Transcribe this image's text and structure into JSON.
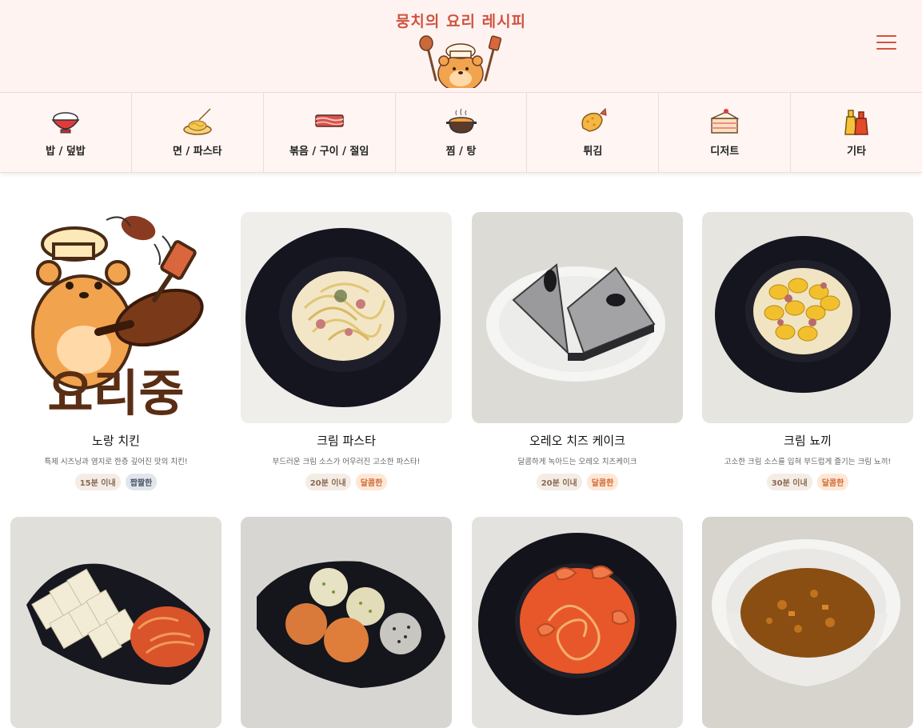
{
  "header": {
    "title": "뭉치의 요리 레시피",
    "menu_icon": "hamburger-menu-icon",
    "accent_color": "#d0533f"
  },
  "categories": [
    {
      "label": "밥 / 덮밥",
      "icon": "rice-bowl-icon"
    },
    {
      "label": "면 / 파스타",
      "icon": "noodle-plate-icon"
    },
    {
      "label": "볶음 / 구이 / 절임",
      "icon": "bacon-icon"
    },
    {
      "label": "찜 / 탕",
      "icon": "stew-pot-icon"
    },
    {
      "label": "튀김",
      "icon": "fried-shrimp-icon"
    },
    {
      "label": "디저트",
      "icon": "cake-slice-icon"
    },
    {
      "label": "기타",
      "icon": "sauce-bottles-icon"
    }
  ],
  "recipes": [
    {
      "title": "노랑 치킨",
      "desc": "특제 시즈닝과 염지로 한층 깊어진 맛의 치킨!",
      "tags": [
        "15분 이내",
        "짭짤한"
      ],
      "image": "cooking-placeholder-mascot",
      "placeholder_text": "요리중"
    },
    {
      "title": "크림 파스타",
      "desc": "부드러운 크림 소스가 어우러진 고소한 파스타!",
      "tags": [
        "20분 이내",
        "달콤한"
      ],
      "image": "cream-pasta-photo"
    },
    {
      "title": "오레오 치즈 케이크",
      "desc": "달콤하게 녹아드는 오레오 치즈케이크",
      "tags": [
        "20분 이내",
        "달콤한"
      ],
      "image": "oreo-cheesecake-photo"
    },
    {
      "title": "크림 뇨끼",
      "desc": "고소한 크림 소스를 입혀 부드럽게 즐기는 크림 뇨끼!",
      "tags": [
        "30분 이내",
        "달콤한"
      ],
      "image": "cream-gnocchi-photo"
    },
    {
      "image": "tofu-kimchi-photo"
    },
    {
      "image": "rice-balls-photo"
    },
    {
      "image": "shrimp-rose-pasta-photo"
    },
    {
      "image": "curry-rice-photo"
    }
  ]
}
